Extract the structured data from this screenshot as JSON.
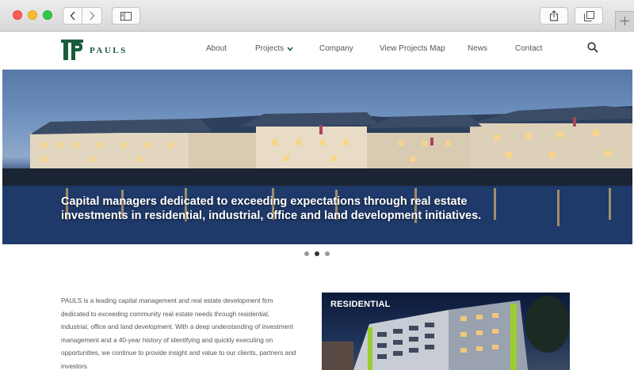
{
  "browser": {
    "buttons": [
      "back",
      "forward",
      "sidebar",
      "share",
      "tabs",
      "new-tab"
    ]
  },
  "header": {
    "logo_text": "PAULS",
    "menu": [
      {
        "label": "About"
      },
      {
        "label": "Projects",
        "has_dropdown": true
      },
      {
        "label": "Company"
      },
      {
        "label": "View Projects Map"
      },
      {
        "label": "News"
      },
      {
        "label": "Contact"
      }
    ],
    "search_icon": "search-icon",
    "brand_color": "#1a5c3a"
  },
  "hero": {
    "caption_line1": "Capital managers dedicated to exceeding expectations through real estate",
    "caption_line2": "investments in residential, industrial, office and land development initiatives.",
    "slides_count": 3,
    "active_slide": 2
  },
  "intro": {
    "text": "PAULS is a leading capital management and real estate development firm dedicated to exceeding community real estate needs through residential, industrial, office and land development. With a deep understanding of investment management and a 40-year history of identifying and quickly executing on opportunities, we continue to provide insight and value to our clients, partners and investors."
  },
  "feature": {
    "title": "RESIDENTIAL"
  }
}
